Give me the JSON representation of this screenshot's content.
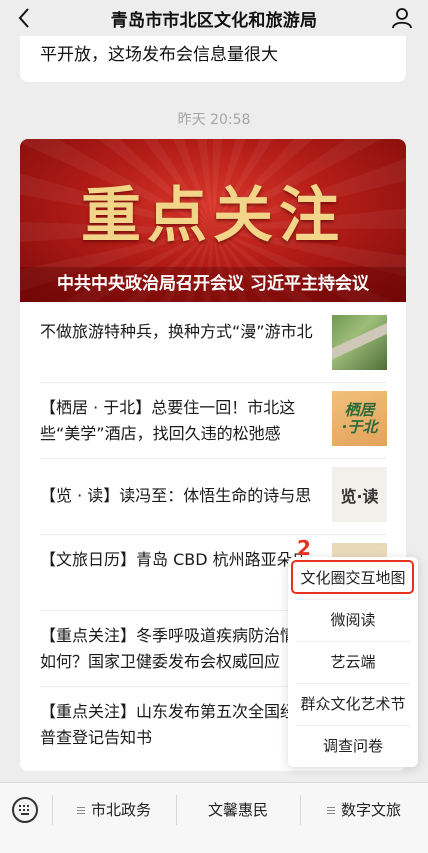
{
  "header": {
    "title": "青岛市市北区文化和旅游局",
    "back_icon": "chevron-left-icon",
    "profile_icon": "user-icon"
  },
  "previous_message": {
    "text": "平开放，这场发布会信息量很大"
  },
  "timestamp": "昨天 20:58",
  "banner": {
    "headline": "重点关注",
    "subtitle": "中共中央政治局召开会议 习近平主持会议"
  },
  "articles": [
    {
      "title": "不做旅游特种兵，换种方式“漫”游市北",
      "thumb_text": ""
    },
    {
      "title": "【栖居 · 于北】总要住一回！市北这些“美学”酒店，找回久违的松弛感",
      "thumb_text_1": "栖居",
      "thumb_text_2": "·于北"
    },
    {
      "title": "【览 · 读】读冯至：体悟生命的诗与思",
      "thumb_text": "览·读"
    },
    {
      "title": "【文旅日历】青岛 CBD 杭州路亚朵店",
      "thumb_text": ""
    },
    {
      "title": "【重点关注】冬季呼吸道疾病防治情况如何？国家卫健委发布会权威回应",
      "thumb_text": ""
    },
    {
      "title": "【重点关注】山东发布第五次全国经济普查登记告知书",
      "thumb_text": ""
    }
  ],
  "annotation": {
    "step_number": "2",
    "color": "#e8311f"
  },
  "popup_menu": {
    "items": [
      "文化圈交互地图",
      "微阅读",
      "艺云端",
      "群众文化艺术节",
      "调查问卷"
    ]
  },
  "bottom_bar": {
    "keyboard_icon": "keyboard-icon",
    "tabs": [
      "市北政务",
      "文馨惠民",
      "数字文旅"
    ]
  }
}
